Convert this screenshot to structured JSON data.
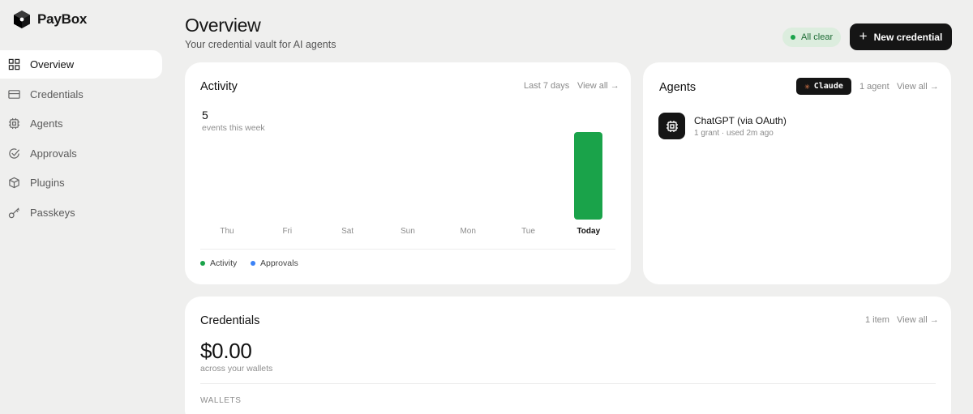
{
  "brand": {
    "name": "PayBox"
  },
  "sidebar": {
    "items": [
      {
        "label": "Overview",
        "icon": "grid-icon",
        "active": true
      },
      {
        "label": "Credentials",
        "icon": "card-icon"
      },
      {
        "label": "Agents",
        "icon": "chip-icon"
      },
      {
        "label": "Approvals",
        "icon": "check-circle-icon"
      },
      {
        "label": "Plugins",
        "icon": "cube-icon"
      },
      {
        "label": "Passkeys",
        "icon": "key-icon"
      }
    ]
  },
  "header": {
    "title": "Overview",
    "subtitle": "Your credential vault for AI agents",
    "status": "All clear",
    "new_button": "New credential"
  },
  "activity": {
    "title": "Activity",
    "range": "Last 7 days",
    "view_all": "View all →",
    "count": "5",
    "count_label": "events this week",
    "legend": {
      "activity": "Activity",
      "approvals": "Approvals"
    }
  },
  "chart_data": {
    "type": "bar",
    "categories": [
      "Thu",
      "Fri",
      "Sat",
      "Sun",
      "Mon",
      "Tue",
      "Today"
    ],
    "series": [
      {
        "name": "Activity",
        "values": [
          0,
          0,
          0,
          0,
          0,
          0,
          5
        ],
        "color": "#1aa34a"
      },
      {
        "name": "Approvals",
        "values": [
          0,
          0,
          0,
          0,
          0,
          0,
          0
        ],
        "color": "#3b82f6"
      }
    ]
  },
  "agents": {
    "title": "Agents",
    "badge": "Claude",
    "count": "1 agent",
    "view_all": "View all →",
    "items": [
      {
        "name": "ChatGPT (via OAuth)",
        "detail": "1 grant · used 2m ago",
        "icon": "chip-icon"
      }
    ]
  },
  "credentials": {
    "title": "Credentials",
    "count": "1 item",
    "view_all": "View all →",
    "balance": "$0.00",
    "balance_label": "across your wallets",
    "section": "WALLETS"
  },
  "colors": {
    "accent": "#151515",
    "success": "#1aa34a",
    "info": "#3b82f6"
  }
}
